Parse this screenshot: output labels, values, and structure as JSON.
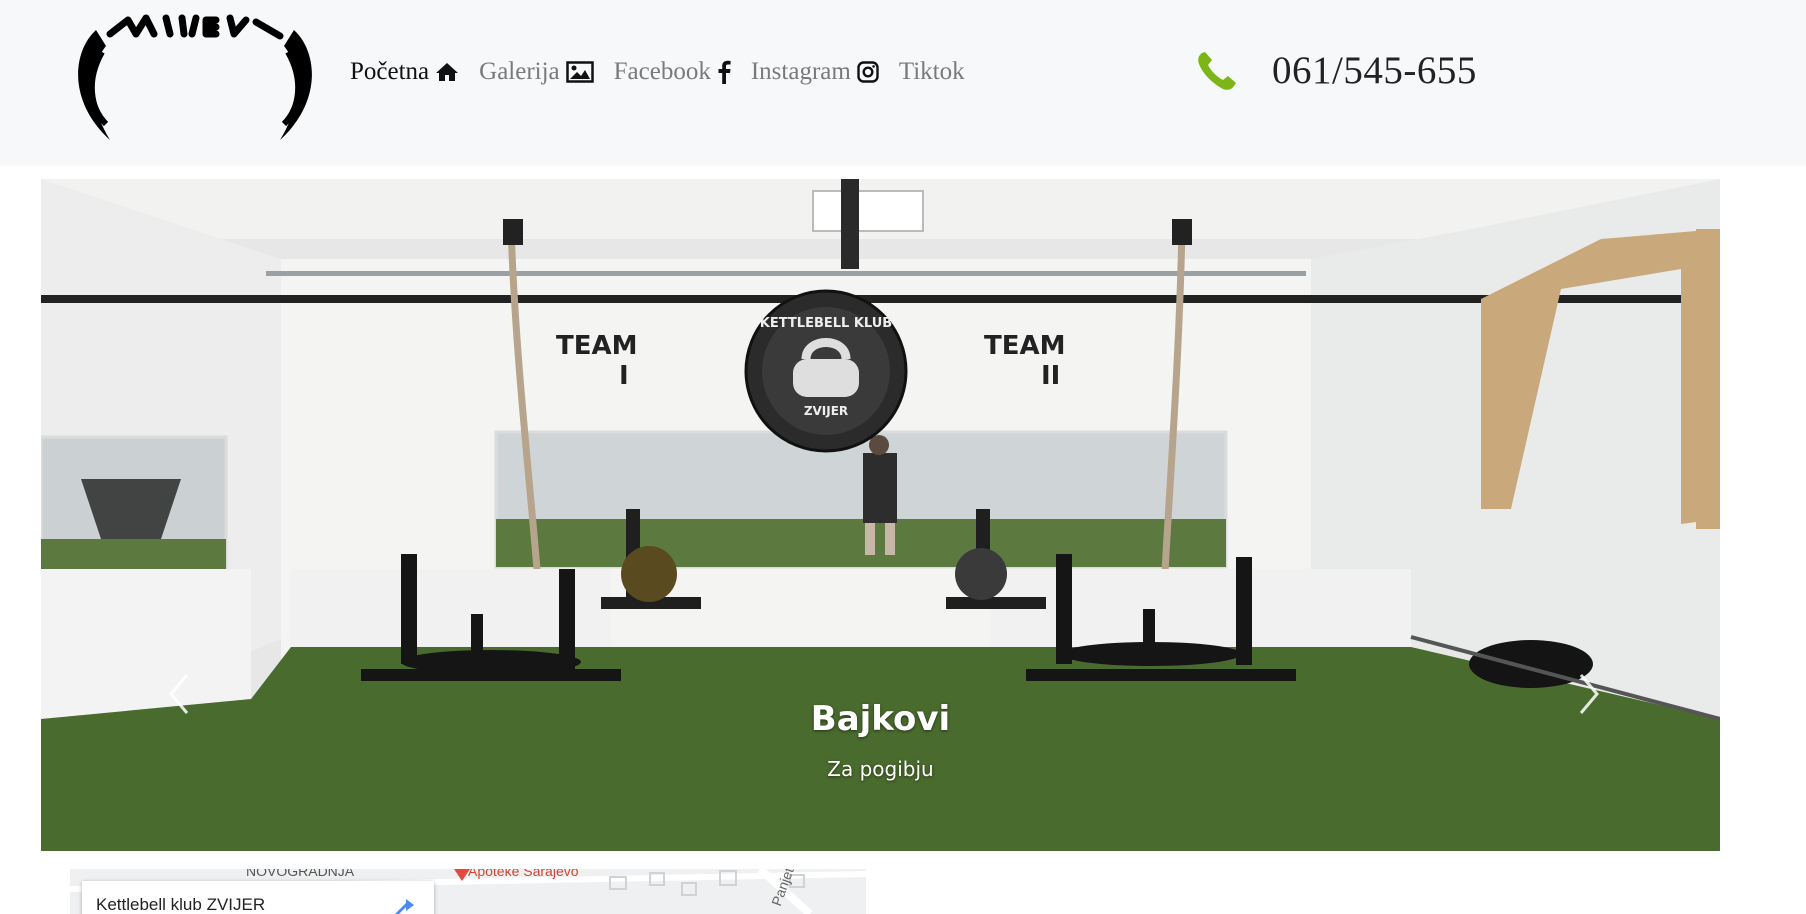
{
  "header": {
    "logo_icon": "zvijer-jaw-logo",
    "nav": [
      {
        "label": "Početna",
        "icon": "home-icon",
        "active": true
      },
      {
        "label": "Galerija",
        "icon": "image-icon",
        "active": false
      },
      {
        "label": "Facebook",
        "icon": "facebook-icon",
        "active": false
      },
      {
        "label": "Instagram",
        "icon": "instagram-icon",
        "active": false
      },
      {
        "label": "Tiktok",
        "icon": "",
        "active": false
      }
    ],
    "phone": {
      "icon": "phone-icon",
      "number": "061/545-655",
      "icon_color": "#7cb518"
    }
  },
  "carousel": {
    "slide": {
      "title": "Bajkovi",
      "subtitle": "Za pogibju",
      "wall_signs": [
        "TEAM",
        "I",
        "TEAM",
        "II",
        "KETTLEBELL KLUB",
        "ZVIJER"
      ]
    },
    "prev_icon": "chevron-left-icon",
    "next_icon": "chevron-right-icon"
  },
  "map": {
    "place_title": "Kettlebell klub ZVIJER",
    "labels": [
      "NOVOGRADNJA",
      "Apoteke Sarajevo",
      "Panjeta"
    ]
  },
  "colors": {
    "header_bg": "#f7f8f9",
    "turf": "#4a6b2e",
    "accent_green": "#7cb518"
  }
}
